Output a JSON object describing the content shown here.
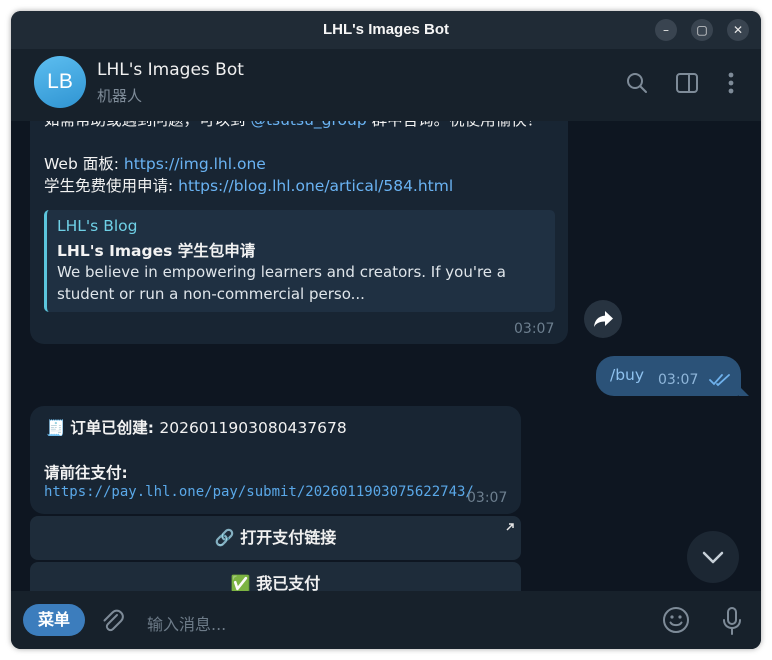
{
  "window": {
    "title": "LHL's Images Bot",
    "controls": {
      "minimize": "–",
      "maximize": "▢",
      "close": "✕"
    }
  },
  "header": {
    "avatar_initials": "LB",
    "bot_name": "LHL's Images Bot",
    "bot_subtitle": "机器人",
    "icons": [
      "search-icon",
      "sidebar-toggle-icon",
      "more-vert-icon"
    ]
  },
  "messages": {
    "m1": {
      "partial_line": "如需帮助或遇到问题，可以到 @tsutsu_group 群中咨询。祝使用愉快！",
      "partial_pre": "如需帮助或遇到问题，可以到 ",
      "partial_link": "@tsutsu_group",
      "partial_post": " 群中咨询。祝使用愉快！",
      "web_label": "Web 面板: ",
      "web_link": "https://img.lhl.one",
      "student_label": "学生免费使用申请: ",
      "student_link": "https://blog.lhl.one/artical/584.html",
      "preview": {
        "site": "LHL's Blog",
        "title": "LHL's Images 学生包申请",
        "description": "We believe in empowering learners and creators. If you're a student or run a non-commercial perso..."
      },
      "time": "03:07"
    },
    "m2": {
      "text": "/buy",
      "time": "03:07",
      "status_icon": "double-check-icon"
    },
    "m3": {
      "emoji": "🧾",
      "order_label": "订单已创建: ",
      "order_id": "20260119030804376 78",
      "order_id_display": "2026011903080437678",
      "pay_prompt": "请前往支付:",
      "pay_link": "https://pay.lhl.one/pay/submit/2026011903075622743/",
      "time": "03:07"
    }
  },
  "keyboard": {
    "open_link_label": "🔗 打开支付链接",
    "paid_label": "✅ 我已支付"
  },
  "input": {
    "menu_label": "菜单",
    "placeholder": "输入消息..."
  },
  "colors": {
    "background": "#0e1621",
    "header": "#17212b",
    "incoming_bubble": "#182533",
    "outgoing_bubble": "#2b5278",
    "link": "#6ab3f3",
    "accent": "#3c7dbd"
  }
}
